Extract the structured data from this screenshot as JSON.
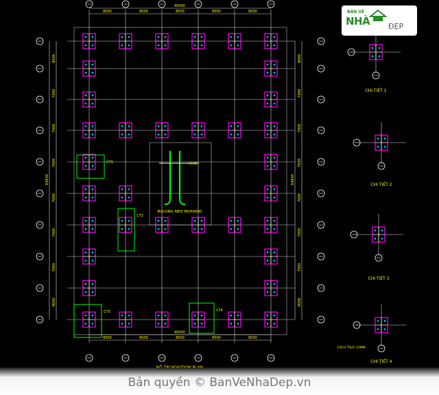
{
  "drawing": {
    "title": "BỐ TRÍ POSITION PLAN",
    "top_total": "40000",
    "bottom_total": "40000",
    "top_dims": [
      "8000",
      "8000",
      "8000",
      "8000",
      "8000"
    ],
    "bottom_dims": [
      "8000",
      "8000",
      "8000",
      "8000",
      "8000"
    ],
    "left_total": "64830",
    "right_total": "64830",
    "left_dims": [
      "8000",
      "7000",
      "7000",
      "7000",
      "7000",
      "7000",
      "7000",
      "8000"
    ],
    "right_dims": [
      "8000",
      "7000",
      "7000",
      "7000",
      "7000",
      "7000",
      "7000",
      "8000"
    ],
    "anchor_label": "BULONG NEO M24X600",
    "level_label": "+0.00",
    "detail_tags": [
      "CT1",
      "CT2",
      "CT3",
      "CT4"
    ],
    "colors": {
      "grid": "#d8d8d8",
      "column": "#ff00ff",
      "anchor": "#00ccff",
      "detail": "#00ff00",
      "text": "#ffff00"
    }
  },
  "details": [
    {
      "label": "CHI TIẾT 1"
    },
    {
      "label": "CHI TIẾT 2"
    },
    {
      "label": "CHI TIẾT 3"
    },
    {
      "label": "CHI TIẾT 4"
    }
  ],
  "axis_note": "CÁCH TRỤC 10MM",
  "logo": {
    "line1": "BẢN VẼ",
    "line2": "NHÀ",
    "line3": "ĐẸP"
  },
  "footer": {
    "text": "Bản quyền © BanVeNhaDep.vn"
  }
}
